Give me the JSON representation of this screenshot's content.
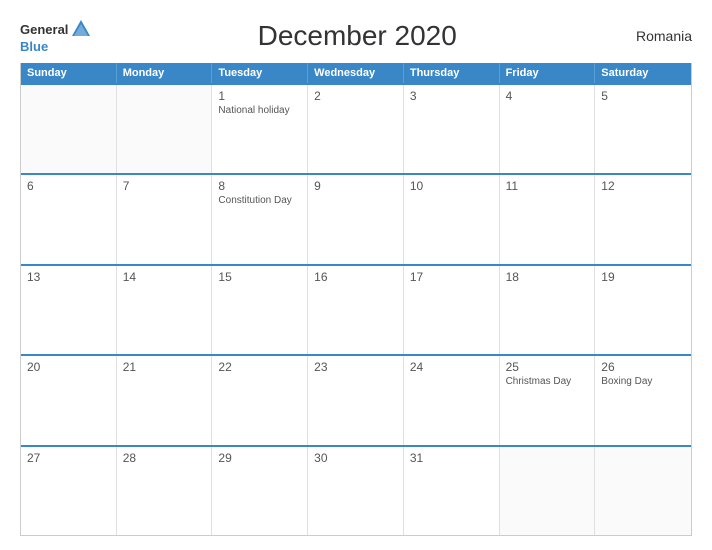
{
  "header": {
    "title": "December 2020",
    "country": "Romania",
    "logo": {
      "general": "General",
      "blue": "Blue"
    }
  },
  "calendar": {
    "days_of_week": [
      "Sunday",
      "Monday",
      "Tuesday",
      "Wednesday",
      "Thursday",
      "Friday",
      "Saturday"
    ],
    "weeks": [
      [
        {
          "day": "",
          "event": "",
          "empty": true
        },
        {
          "day": "",
          "event": "",
          "empty": true
        },
        {
          "day": "1",
          "event": "National holiday",
          "empty": false
        },
        {
          "day": "2",
          "event": "",
          "empty": false
        },
        {
          "day": "3",
          "event": "",
          "empty": false
        },
        {
          "day": "4",
          "event": "",
          "empty": false
        },
        {
          "day": "5",
          "event": "",
          "empty": false
        }
      ],
      [
        {
          "day": "6",
          "event": "",
          "empty": false
        },
        {
          "day": "7",
          "event": "",
          "empty": false
        },
        {
          "day": "8",
          "event": "Constitution Day",
          "empty": false
        },
        {
          "day": "9",
          "event": "",
          "empty": false
        },
        {
          "day": "10",
          "event": "",
          "empty": false
        },
        {
          "day": "11",
          "event": "",
          "empty": false
        },
        {
          "day": "12",
          "event": "",
          "empty": false
        }
      ],
      [
        {
          "day": "13",
          "event": "",
          "empty": false
        },
        {
          "day": "14",
          "event": "",
          "empty": false
        },
        {
          "day": "15",
          "event": "",
          "empty": false
        },
        {
          "day": "16",
          "event": "",
          "empty": false
        },
        {
          "day": "17",
          "event": "",
          "empty": false
        },
        {
          "day": "18",
          "event": "",
          "empty": false
        },
        {
          "day": "19",
          "event": "",
          "empty": false
        }
      ],
      [
        {
          "day": "20",
          "event": "",
          "empty": false
        },
        {
          "day": "21",
          "event": "",
          "empty": false
        },
        {
          "day": "22",
          "event": "",
          "empty": false
        },
        {
          "day": "23",
          "event": "",
          "empty": false
        },
        {
          "day": "24",
          "event": "",
          "empty": false
        },
        {
          "day": "25",
          "event": "Christmas Day",
          "empty": false
        },
        {
          "day": "26",
          "event": "Boxing Day",
          "empty": false
        }
      ],
      [
        {
          "day": "27",
          "event": "",
          "empty": false
        },
        {
          "day": "28",
          "event": "",
          "empty": false
        },
        {
          "day": "29",
          "event": "",
          "empty": false
        },
        {
          "day": "30",
          "event": "",
          "empty": false
        },
        {
          "day": "31",
          "event": "",
          "empty": false
        },
        {
          "day": "",
          "event": "",
          "empty": true
        },
        {
          "day": "",
          "event": "",
          "empty": true
        }
      ]
    ]
  }
}
